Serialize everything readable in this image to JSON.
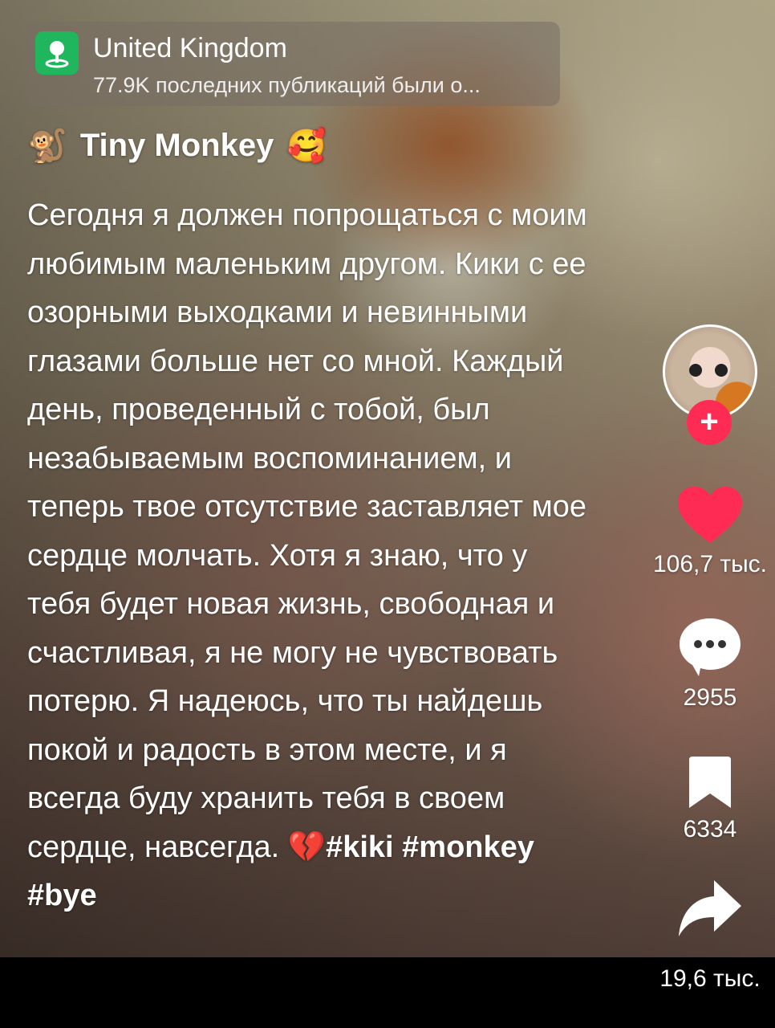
{
  "location": {
    "title": "United Kingdom",
    "subtitle": "77.9K последних публикаций были о..."
  },
  "author": {
    "name": "Tiny Monkey",
    "prefix_emoji": "🐒",
    "suffix_emoji": "🥰"
  },
  "caption": {
    "text": "Сегодня я должен попрощаться с моим любимым маленьким другом. Кики с ее озорными выходками и невинными глазами больше нет со мной. Каждый день, проведенный с тобой, был незабываемым воспоминанием, и теперь твое отсутствие заставляет мое сердце молчать. Хотя я знаю, что у тебя будет новая жизнь, свободная и счастливая, я не могу не чувствовать потерю. Я надеюсь, что ты найдешь покой и радость в этом месте, и я всегда буду хранить тебя в своем сердце, навсегда.",
    "emoji": "💔",
    "hashtags": "#kiki #monkey #bye"
  },
  "actions": {
    "follow_label": "+",
    "likes": "106,7 тыс.",
    "comments": "2955",
    "saves": "6334",
    "shares": "19,6 тыс."
  },
  "colors": {
    "accent": "#fe2c55",
    "location_badge": "#1fb65e"
  },
  "icons": [
    "map-pin-icon",
    "heart-icon",
    "comment-icon",
    "bookmark-icon",
    "share-icon",
    "plus-icon"
  ]
}
